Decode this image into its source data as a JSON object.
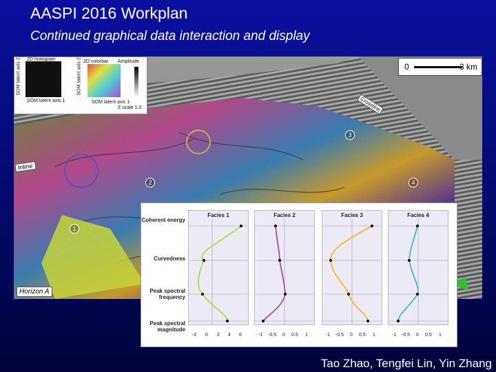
{
  "slide": {
    "title": "AASPI 2016 Workplan",
    "subtitle": "Continued graphical data interaction and display",
    "credits": "Tao Zhao, Tengfei Lin, Yin Zhang"
  },
  "figure": {
    "scale": {
      "start": "0",
      "end": "3 km"
    },
    "labels": {
      "inline": "Inline",
      "crossline": "Crossline",
      "horizon": "Horizon A"
    },
    "markers": [
      "1",
      "2",
      "3",
      "4"
    ],
    "legend_panel": {
      "crossplot_title": "2D histogram",
      "colorbar_title": "2D colorbar",
      "amplitude_label": "Amplitude",
      "axis1": "SOM latent axis 1",
      "axis2": "SOM latent axis 2",
      "zscale": "Z scale 1.0"
    },
    "facies_chart": {
      "row_labels": [
        "Coherent energy",
        "Curvedness",
        "Peak spectral frequency",
        "Peak spectral magnitude"
      ],
      "panels": [
        {
          "title": "Facies 1",
          "color": "#9be03a",
          "ticks": [
            "-2",
            "0",
            "2",
            "4",
            "6"
          ]
        },
        {
          "title": "Facies 2",
          "color": "#a03ab8",
          "ticks": [
            "-1",
            "-0.5",
            "0",
            "0.5",
            "1"
          ]
        },
        {
          "title": "Facies 3",
          "color": "#f5b21a",
          "ticks": [
            "-1",
            "-0.5",
            "0",
            "0.5",
            "1"
          ]
        },
        {
          "title": "Facies 4",
          "color": "#2bb3d6",
          "ticks": [
            "-1",
            "-0.5",
            "0",
            "0.5",
            "1"
          ]
        }
      ]
    }
  }
}
